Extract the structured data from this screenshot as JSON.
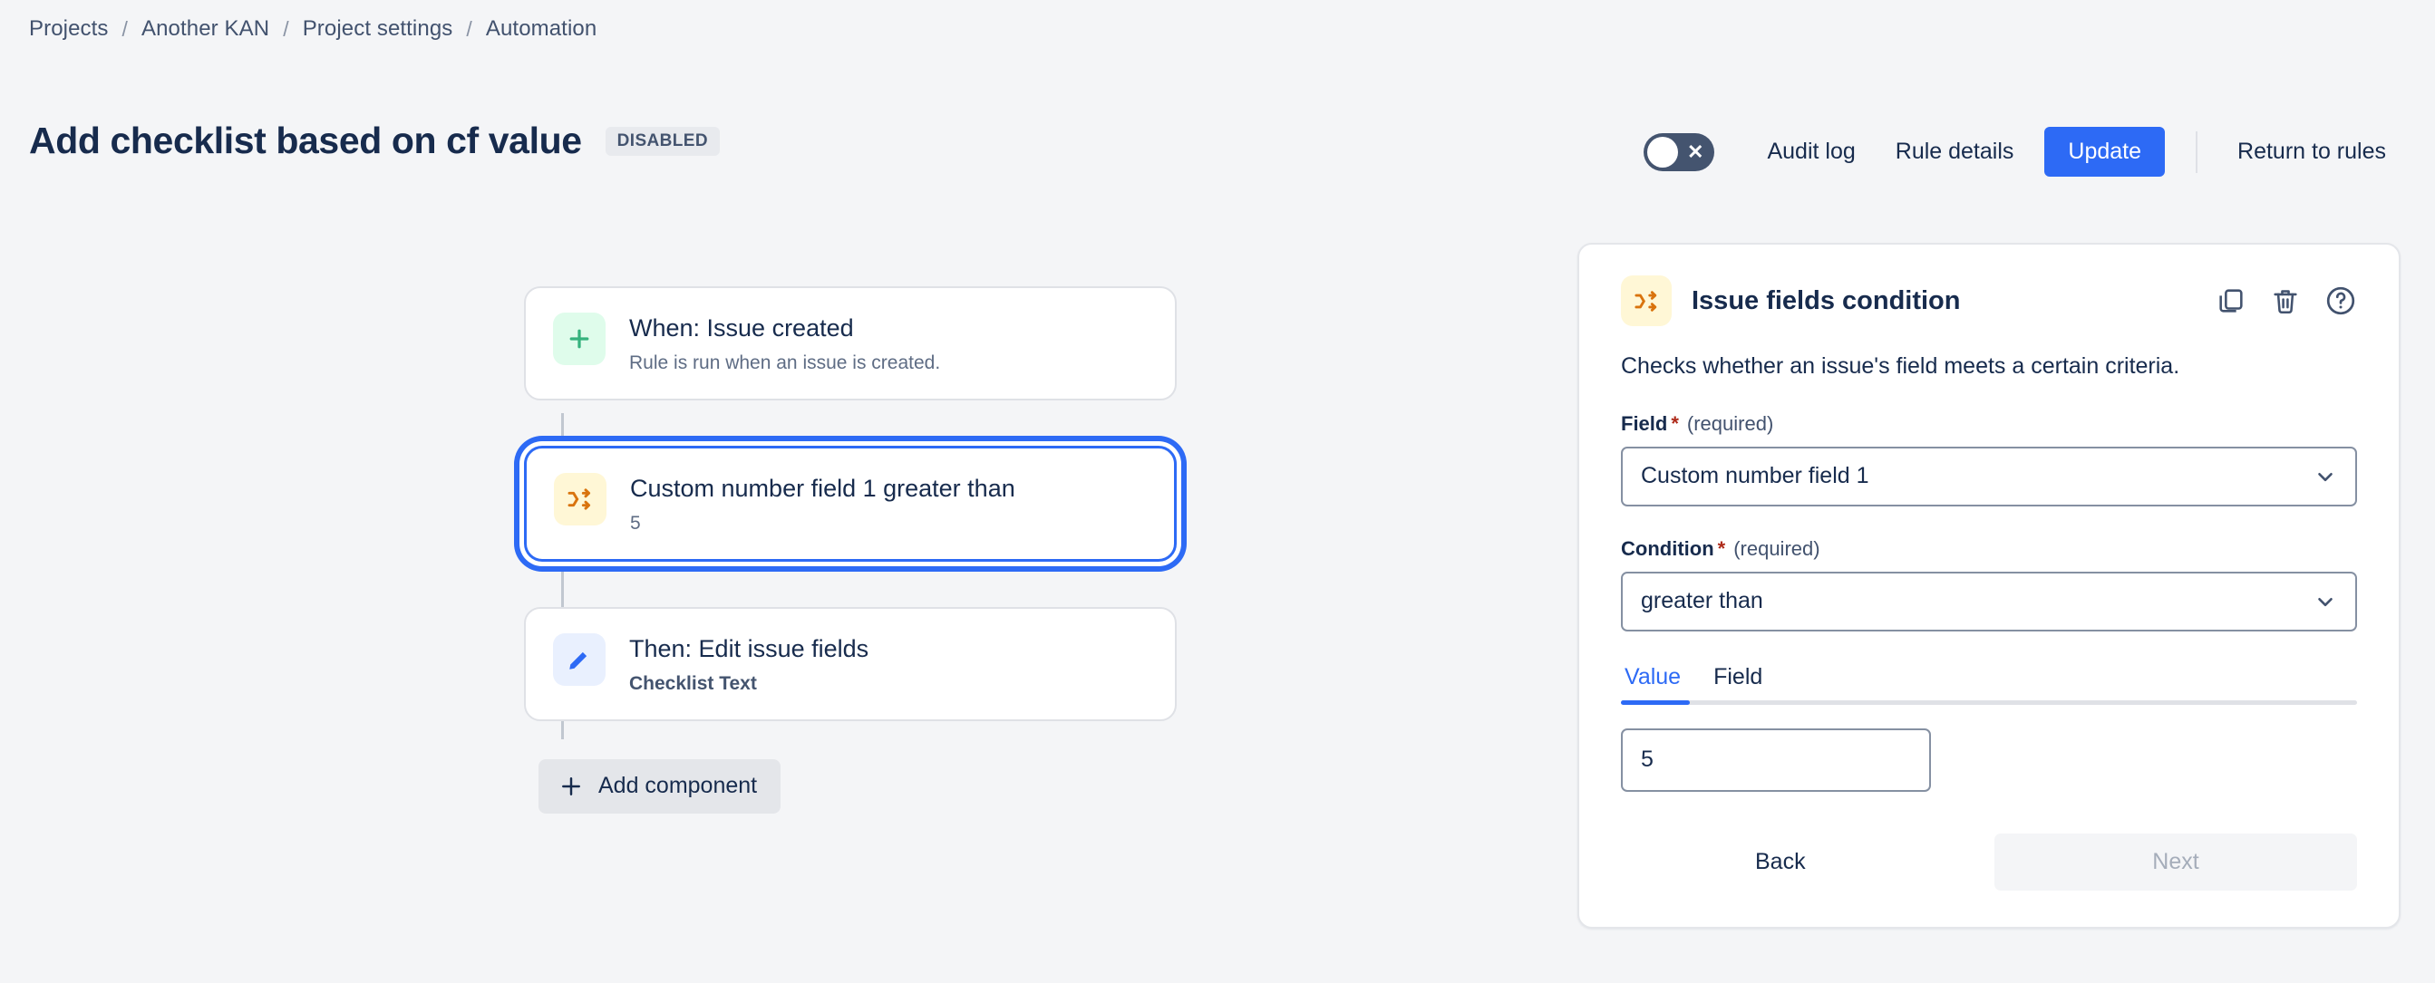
{
  "breadcrumb": {
    "separator": "/",
    "items": [
      {
        "label": "Projects"
      },
      {
        "label": "Another KAN"
      },
      {
        "label": "Project settings"
      },
      {
        "label": "Automation"
      }
    ]
  },
  "header": {
    "title": "Add checklist based on cf value",
    "status_badge": "DISABLED",
    "toggle": {
      "name": "rule-enabled-toggle",
      "state": "off",
      "glyph": "✕"
    },
    "actions": {
      "audit_log": "Audit log",
      "rule_details": "Rule details",
      "update": "Update",
      "return_to_rules": "Return to rules"
    },
    "accent_color": "#2D6AF5"
  },
  "flow": {
    "nodes": [
      {
        "id": "trigger",
        "icon": "plus-icon",
        "icon_bg": "#DFFCEB",
        "title": "When: Issue created",
        "subtitle": "Rule is run when an issue is created.",
        "subtitle_bold": false,
        "selected": false
      },
      {
        "id": "condition",
        "icon": "shuffle-icon",
        "icon_bg": "#FFF7D6",
        "title": "Custom number field 1 greater than",
        "subtitle": "5",
        "subtitle_bold": false,
        "selected": true
      },
      {
        "id": "action",
        "icon": "pencil-icon",
        "icon_bg": "#E9F0FE",
        "title": "Then: Edit issue fields",
        "subtitle": "Checklist Text",
        "subtitle_bold": true,
        "selected": false
      }
    ],
    "add_component_label": "Add component"
  },
  "panel": {
    "icon": "shuffle-icon",
    "title": "Issue fields condition",
    "description": "Checks whether an issue's field meets a certain criteria.",
    "head_actions": [
      {
        "name": "duplicate-icon",
        "label": "Duplicate"
      },
      {
        "name": "trash-icon",
        "label": "Delete"
      },
      {
        "name": "help-icon",
        "label": "Help"
      }
    ],
    "fields": [
      {
        "label": "Field",
        "required_marker": "*",
        "required_text": "(required)",
        "value": "Custom number field 1"
      },
      {
        "label": "Condition",
        "required_marker": "*",
        "required_text": "(required)",
        "value": "greater than"
      }
    ],
    "tabs": [
      {
        "label": "Value",
        "active": true
      },
      {
        "label": "Field",
        "active": false
      }
    ],
    "value_input": {
      "value": "5",
      "placeholder": ""
    },
    "footer": {
      "back": "Back",
      "next": "Next",
      "next_disabled": true
    }
  }
}
